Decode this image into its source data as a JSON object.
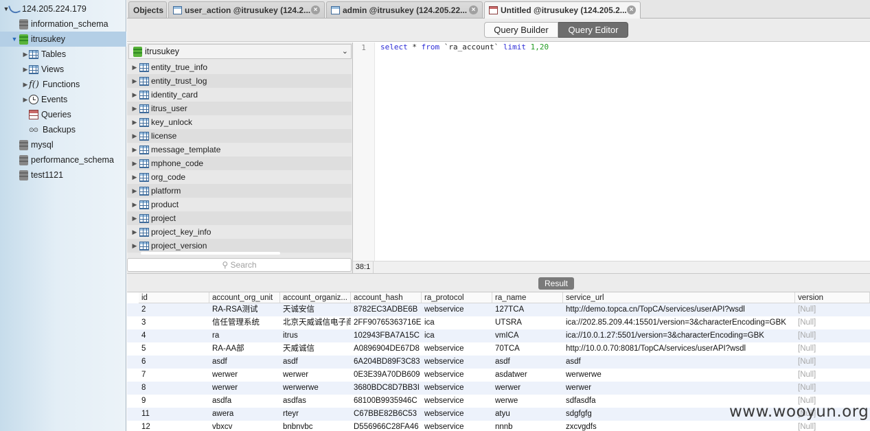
{
  "sidebar": {
    "connection": "124.205.224.179",
    "databases": [
      {
        "name": "information_schema",
        "selected": false
      },
      {
        "name": "itrusukey",
        "selected": true
      },
      {
        "name": "mysql",
        "selected": false
      },
      {
        "name": "performance_schema",
        "selected": false
      },
      {
        "name": "test1121",
        "selected": false
      }
    ],
    "children": [
      "Tables",
      "Views",
      "Functions",
      "Events",
      "Queries",
      "Backups"
    ]
  },
  "tabs": [
    {
      "label": "Objects"
    },
    {
      "label": "user_action @itrusukey (124.2..."
    },
    {
      "label": "admin @itrusukey (124.205.22..."
    },
    {
      "label": "Untitled @itrusukey (124.205.2..."
    }
  ],
  "toolbar": {
    "query_builder": "Query Builder",
    "query_editor": "Query Editor"
  },
  "table_list": {
    "database": "itrusukey",
    "tables": [
      "entity_true_info",
      "entity_trust_log",
      "identity_card",
      "itrus_user",
      "key_unlock",
      "license",
      "message_template",
      "mphone_code",
      "org_code",
      "platform",
      "product",
      "project",
      "project_key_info",
      "project_version"
    ],
    "search_placeholder": "Search"
  },
  "editor": {
    "line_number": "1",
    "code": {
      "select": "select",
      "star": " * ",
      "from": "from",
      "table": " `ra_account` ",
      "limit": "limit",
      "args": " 1,20"
    },
    "cursor_pos": "38:1"
  },
  "result": {
    "button": "Result",
    "columns": [
      "id",
      "account_org_unit",
      "account_organiz...",
      "account_hash",
      "ra_protocol",
      "ra_name",
      "service_url",
      "version"
    ],
    "rows": [
      [
        "2",
        "RA-RSA测试",
        "天诚安信",
        "8782EC3ADBE6B",
        "webservice",
        "127TCA",
        "http://demo.topca.cn/TopCA/services/userAPI?wsdl",
        "[Null]"
      ],
      [
        "3",
        "信任管理系统",
        "北京天威诚信电子商",
        "2FF90765363716E",
        "ica",
        "UTSRA",
        "ica://202.85.209.44:15501/version=3&characterEncoding=GBK",
        "[Null]"
      ],
      [
        "4",
        "ra",
        "itrus",
        "102943FBA7A15C",
        "ica",
        "vmICA",
        "ica://10.0.1.27:5501/version=3&characterEncoding=GBK",
        "[Null]"
      ],
      [
        "5",
        "RA-AA部",
        "天威诚信",
        "A0896904DE67D8",
        "webservice",
        "70TCA",
        "http://10.0.0.70:8081/TopCA/services/userAPI?wsdl",
        "[Null]"
      ],
      [
        "6",
        "asdf",
        "asdf",
        "6A204BD89F3C83",
        "webservice",
        "asdf",
        "asdf",
        "[Null]"
      ],
      [
        "7",
        "werwer",
        "werwer",
        "0E3E39A70DB609",
        "webservice",
        "asdatwer",
        "werwerwe",
        "[Null]"
      ],
      [
        "8",
        "werwer",
        "werwerwe",
        "3680BDC8D7BB3I",
        "webservice",
        "werwer",
        "werwer",
        "[Null]"
      ],
      [
        "9",
        "asdfa",
        "asdfas",
        "68100B9935946C",
        "webservice",
        "werwe",
        "sdfasdfa",
        "[Null]"
      ],
      [
        "11",
        "awera",
        "rteyr",
        "C67BBE82B6C53",
        "webservice",
        "atyu",
        "sdgfgfg",
        "[Null]"
      ],
      [
        "12",
        "vbxcv",
        "bnbnvbc",
        "D556966C28FA46",
        "webservice",
        "nnnb",
        "zxcvgdfs",
        "[Null]"
      ]
    ]
  },
  "watermark": "www.wooyun.org"
}
